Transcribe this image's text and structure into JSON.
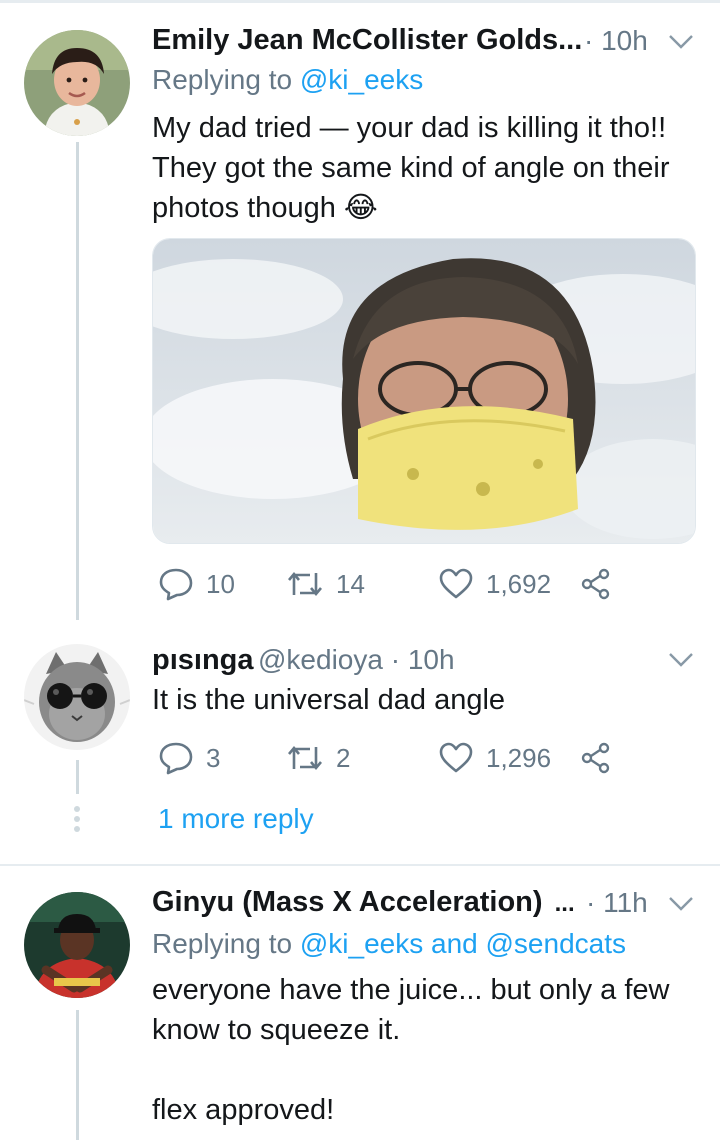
{
  "tweets": [
    {
      "name": "Emily Jean McCollister Golds...",
      "time": "· 10h",
      "replying_prefix": "Replying to",
      "replying_handles": "@ki_eeks",
      "text": "My dad tried — your dad is killing it tho!!\nThey got the same kind of angle on their\nphotos though",
      "emoji": "😂",
      "media_desc": "selfie-man-yellow-bandana-mask-sky",
      "replies": "10",
      "retweets": "14",
      "likes": "1,692"
    },
    {
      "name": "pısınga",
      "handle_time": "@kedioya · 10h",
      "text": "It is the universal dad angle",
      "replies": "3",
      "retweets": "2",
      "likes": "1,296",
      "more_replies": "1 more reply"
    },
    {
      "name": "Ginyu (Mass X Acceleration)",
      "name_ellipsis": "...",
      "time": "· 11h",
      "replying_prefix": "Replying to",
      "replying_handles": "@ki_eeks and @sendcats",
      "text": "everyone have the juice... but only a few\nknow to squeeze it.\n\nflex approved!"
    }
  ],
  "colors": {
    "link": "#1da1f2",
    "secondary": "#657786",
    "primary": "#14171a",
    "divider": "#e6ecf0"
  }
}
